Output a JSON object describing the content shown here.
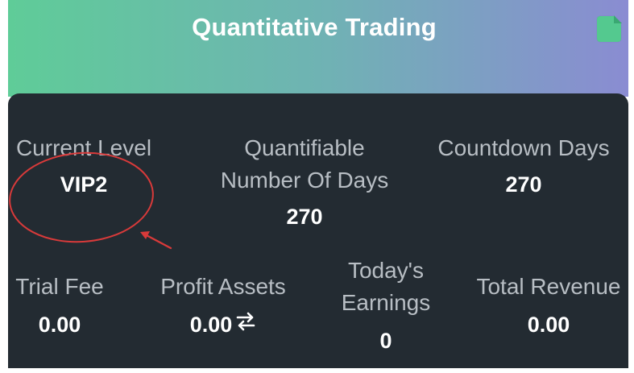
{
  "header": {
    "title": "Quantitative Trading"
  },
  "stats": {
    "current_level": {
      "label": "Current Level",
      "value": "VIP2"
    },
    "quantifiable_days": {
      "label_line1": "Quantifiable",
      "label_line2": "Number Of Days",
      "value": "270"
    },
    "countdown_days": {
      "label": "Countdown Days",
      "value": "270"
    },
    "trial_fee": {
      "label": "Trial Fee",
      "value": "0.00"
    },
    "profit_assets": {
      "label": "Profit Assets",
      "value": "0.00"
    },
    "todays_earnings": {
      "label_line1": "Today's",
      "label_line2": "Earnings",
      "value": "0"
    },
    "total_revenue": {
      "label": "Total Revenue",
      "value": "0.00"
    }
  },
  "icons": {
    "header_icon": "document-icon",
    "swap_icon": "swap-arrows-icon"
  },
  "colors": {
    "header_gradient_start": "#5fcc98",
    "header_gradient_end": "#8a8cd2",
    "panel_bg": "#232b32",
    "annotation": "#d83a3a"
  }
}
